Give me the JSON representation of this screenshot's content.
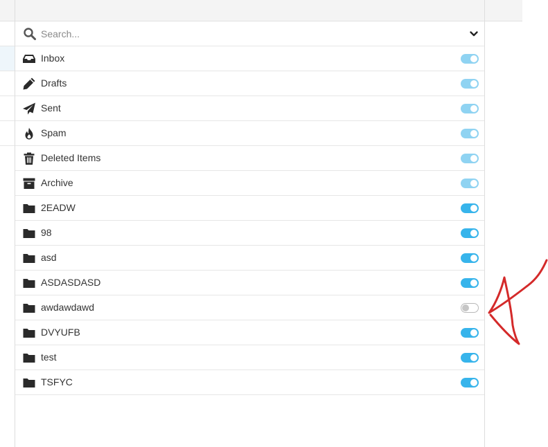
{
  "search": {
    "placeholder": "Search..."
  },
  "colors": {
    "toggle_on": "#37b4eb",
    "toggle_on_disabled": "#8fd3f2",
    "toggle_off_border": "#b8b8b8",
    "icon": "#2a2a2a",
    "annotation": "#d42a2a"
  },
  "folders": [
    {
      "name": "Inbox",
      "icon": "inbox-icon",
      "subscribed": true,
      "locked": true
    },
    {
      "name": "Drafts",
      "icon": "pencil-icon",
      "subscribed": true,
      "locked": true
    },
    {
      "name": "Sent",
      "icon": "paper-plane-icon",
      "subscribed": true,
      "locked": true
    },
    {
      "name": "Spam",
      "icon": "fire-icon",
      "subscribed": true,
      "locked": true
    },
    {
      "name": "Deleted Items",
      "icon": "trash-icon",
      "subscribed": true,
      "locked": true
    },
    {
      "name": "Archive",
      "icon": "archive-box-icon",
      "subscribed": true,
      "locked": true
    },
    {
      "name": "2EADW",
      "icon": "folder-icon",
      "subscribed": true,
      "locked": false
    },
    {
      "name": "98",
      "icon": "folder-icon",
      "subscribed": true,
      "locked": false
    },
    {
      "name": "asd",
      "icon": "folder-icon",
      "subscribed": true,
      "locked": false
    },
    {
      "name": "ASDASDASD",
      "icon": "folder-icon",
      "subscribed": true,
      "locked": false
    },
    {
      "name": "awdawdawd",
      "icon": "folder-icon",
      "subscribed": false,
      "locked": false
    },
    {
      "name": "DVYUFB",
      "icon": "folder-icon",
      "subscribed": true,
      "locked": false
    },
    {
      "name": "test",
      "icon": "folder-icon",
      "subscribed": true,
      "locked": false
    },
    {
      "name": "TSFYC",
      "icon": "folder-icon",
      "subscribed": true,
      "locked": false
    }
  ]
}
